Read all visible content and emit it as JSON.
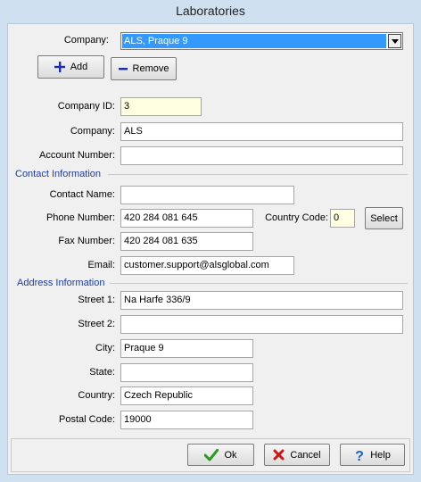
{
  "window": {
    "title": "Laboratories"
  },
  "top": {
    "company_label": "Company:",
    "company_selected": "ALS, Praque 9",
    "add_label": "Add",
    "remove_label": "Remove"
  },
  "fields": {
    "company_id": {
      "label": "Company ID:",
      "value": "3"
    },
    "company": {
      "label": "Company:",
      "value": "ALS"
    },
    "account_number": {
      "label": "Account Number:",
      "value": ""
    }
  },
  "contact": {
    "title": "Contact Information",
    "contact_name": {
      "label": "Contact Name:",
      "value": ""
    },
    "phone": {
      "label": "Phone Number:",
      "value": "420 284 081 645"
    },
    "country_code": {
      "label": "Country Code:",
      "value": "0"
    },
    "select_label": "Select",
    "fax": {
      "label": "Fax Number:",
      "value": "420 284 081 635"
    },
    "email": {
      "label": "Email:",
      "value": "customer.support@alsglobal.com"
    }
  },
  "address": {
    "title": "Address Information",
    "street1": {
      "label": "Street 1:",
      "value": "Na Harfe 336/9"
    },
    "street2": {
      "label": "Street 2:",
      "value": ""
    },
    "city": {
      "label": "City:",
      "value": "Praque 9"
    },
    "state": {
      "label": "State:",
      "value": ""
    },
    "country": {
      "label": "Country:",
      "value": "Czech Republic"
    },
    "postal_code": {
      "label": "Postal Code:",
      "value": "19000"
    }
  },
  "footer": {
    "ok_label": "Ok",
    "cancel_label": "Cancel",
    "help_label": "Help"
  },
  "colors": {
    "window_frame": "#cfe1f1",
    "group_title": "#1a3caa",
    "selection": "#3399ff",
    "readonly_field": "#ffffe1"
  }
}
